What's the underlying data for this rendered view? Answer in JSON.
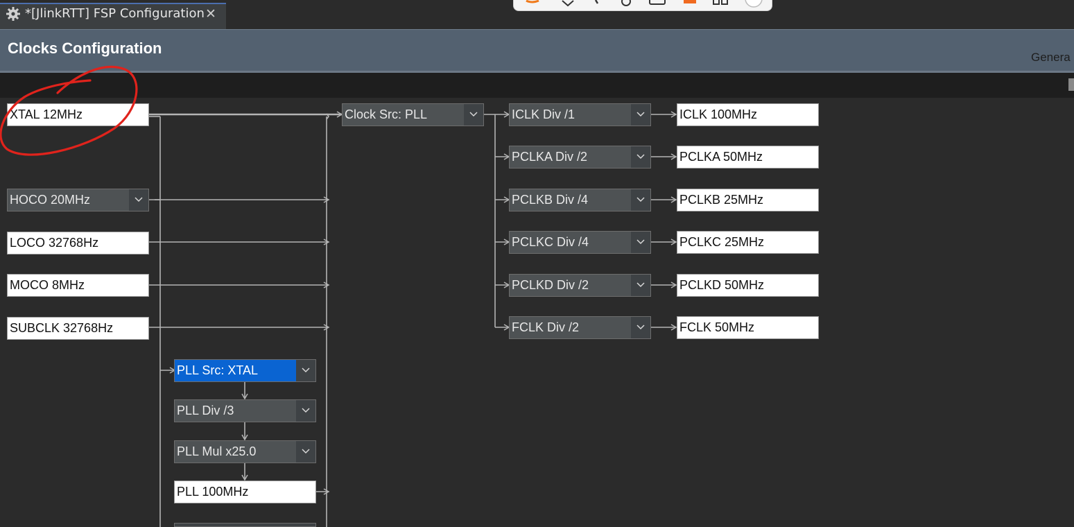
{
  "tab": {
    "title": "*[JlinkRTT] FSP Configuration",
    "close": "✕"
  },
  "header": {
    "title": "Clocks Configuration",
    "link": "Genera"
  },
  "sources": {
    "xtal": "XTAL 12MHz",
    "hoco": "HOCO 20MHz",
    "loco": "LOCO 32768Hz",
    "moco": "MOCO 8MHz",
    "subclk": "SUBCLK 32768Hz"
  },
  "clock_src": "Clock Src: PLL",
  "dividers": [
    {
      "select": "ICLK Div /1",
      "output": "ICLK 100MHz"
    },
    {
      "select": "PCLKA Div /2",
      "output": "PCLKA 50MHz"
    },
    {
      "select": "PCLKB Div /4",
      "output": "PCLKB 25MHz"
    },
    {
      "select": "PCLKC Div /4",
      "output": "PCLKC 25MHz"
    },
    {
      "select": "PCLKD Div /2",
      "output": "PCLKD 50MHz"
    },
    {
      "select": "FCLK Div /2",
      "output": "FCLK 50MHz"
    }
  ],
  "pll": {
    "src": "PLL Src: XTAL",
    "div": "PLL Div /3",
    "mul": "PLL Mul x25.0",
    "output": "PLL 100MHz"
  },
  "colors": {
    "header_bg": "#536170",
    "canvas_bg": "#2b2b2b",
    "selected": "#0a64d2",
    "annotation": "#e0231c"
  }
}
